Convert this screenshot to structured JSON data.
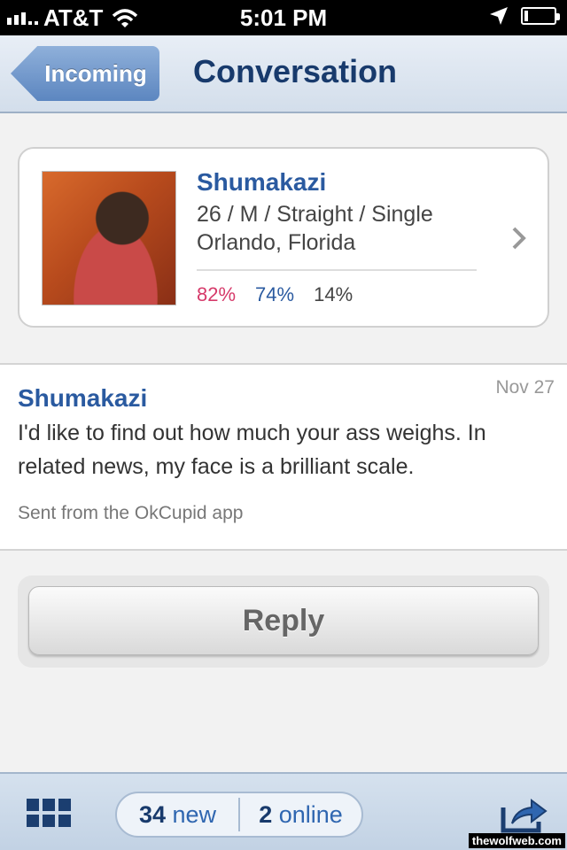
{
  "status_bar": {
    "carrier": "AT&T",
    "time": "5:01 PM"
  },
  "nav": {
    "back_label": "Incoming",
    "title": "Conversation"
  },
  "profile": {
    "name": "Shumakazi",
    "details": "26 / M / Straight / Single",
    "location": "Orlando, Florida",
    "match": "82%",
    "friend": "74%",
    "enemy": "14%",
    "colors": {
      "match": "#d63a6a",
      "friend": "#2a5aa0",
      "enemy": "#444444"
    }
  },
  "message": {
    "sender": "Shumakazi",
    "date": "Nov 27",
    "body": "I'd like to find out how much your ass weighs. In related news, my face is a brilliant scale.",
    "footer": "Sent from the OkCupid app"
  },
  "reply": {
    "label": "Reply"
  },
  "tabbar": {
    "new_count": "34",
    "new_label": "new",
    "online_count": "2",
    "online_label": "online"
  },
  "watermark": "thewolfweb.com",
  "icons": [
    "signal-icon",
    "wifi-icon",
    "location-icon",
    "battery-icon",
    "chevron-right-icon",
    "grid-icon",
    "share-icon"
  ]
}
